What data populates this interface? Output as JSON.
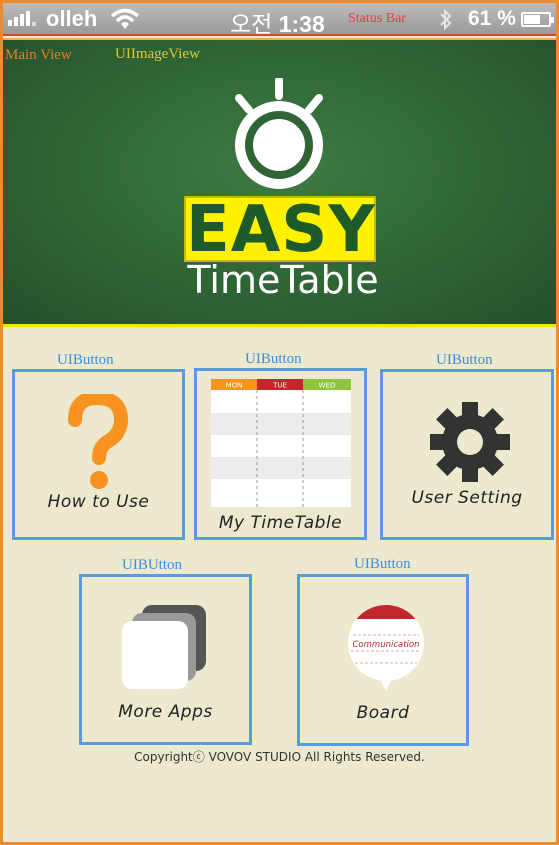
{
  "status_bar": {
    "carrier": "olleh",
    "time_prefix": "오전",
    "time": "1:38",
    "annotation": "Status Bar",
    "battery_percent": "61 %",
    "battery_level": 0.61
  },
  "hero": {
    "main_view_label": "Main View",
    "imageview_label": "UIImageView",
    "logo_word": "EASY",
    "logo_subtitle": "TimeTable"
  },
  "buttons": [
    {
      "annotation": "UIButton",
      "caption": "How to Use",
      "icon": "question-mark-icon"
    },
    {
      "annotation": "UIButton",
      "caption": "My TimeTable",
      "icon": "timetable-icon",
      "days": [
        "MON",
        "TUE",
        "WED"
      ]
    },
    {
      "annotation": "UIButton",
      "caption": "User Setting",
      "icon": "gear-icon"
    },
    {
      "annotation": "UIBUtton",
      "caption": "More Apps",
      "icon": "stacked-apps-icon"
    },
    {
      "annotation": "UIButton",
      "caption": "Board",
      "icon": "speech-bubble-icon",
      "bubble_text": "Communication"
    }
  ],
  "copyright": "Copyrightⓒ VOVOV STUDIO  All Rights Reserved.",
  "colors": {
    "annotation_blue": "#3a8fe0",
    "button_border": "#5a9be0",
    "hero_green": "#2f6535",
    "logo_yellow": "#fff200",
    "background": "#ece9cf"
  }
}
